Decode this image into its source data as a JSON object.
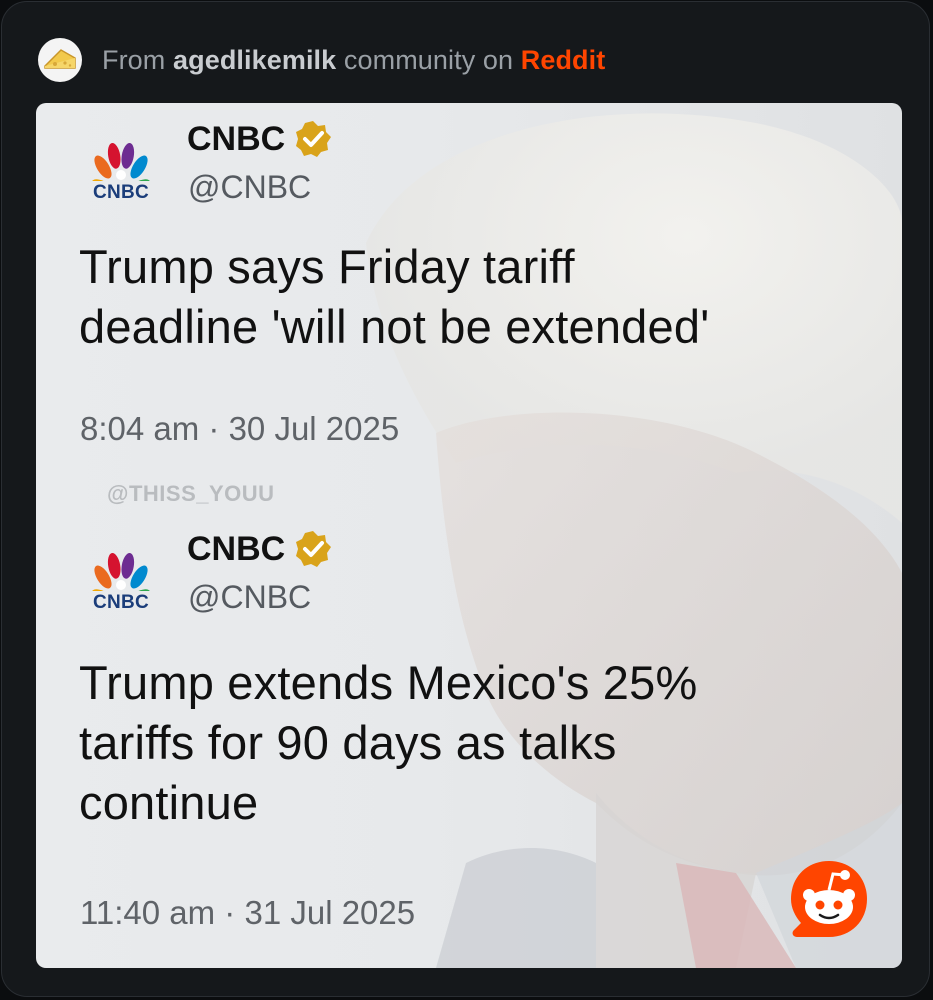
{
  "header": {
    "prefix": "From ",
    "community": "agedlikemilk",
    "middle": " community on ",
    "platform": "Reddit",
    "avatar_icon": "cheese-icon"
  },
  "tweets": [
    {
      "logo_word": "CNBC",
      "name": "CNBC",
      "handle": "@CNBC",
      "text": "Trump says Friday tariff\ndeadline 'will not be extended'",
      "time": "8:04 am · 30 Jul 2025"
    },
    {
      "logo_word": "CNBC",
      "name": "CNBC",
      "handle": "@CNBC",
      "text": "Trump extends Mexico's 25%\ntariffs for 90 days as talks\ncontinue",
      "time": "11:40 am · 31 Jul 2025"
    }
  ],
  "watermark": "@THISS_YOUU",
  "colors": {
    "reddit": "#ff4500",
    "verified": "#d9a31a",
    "background": "#15181b"
  }
}
